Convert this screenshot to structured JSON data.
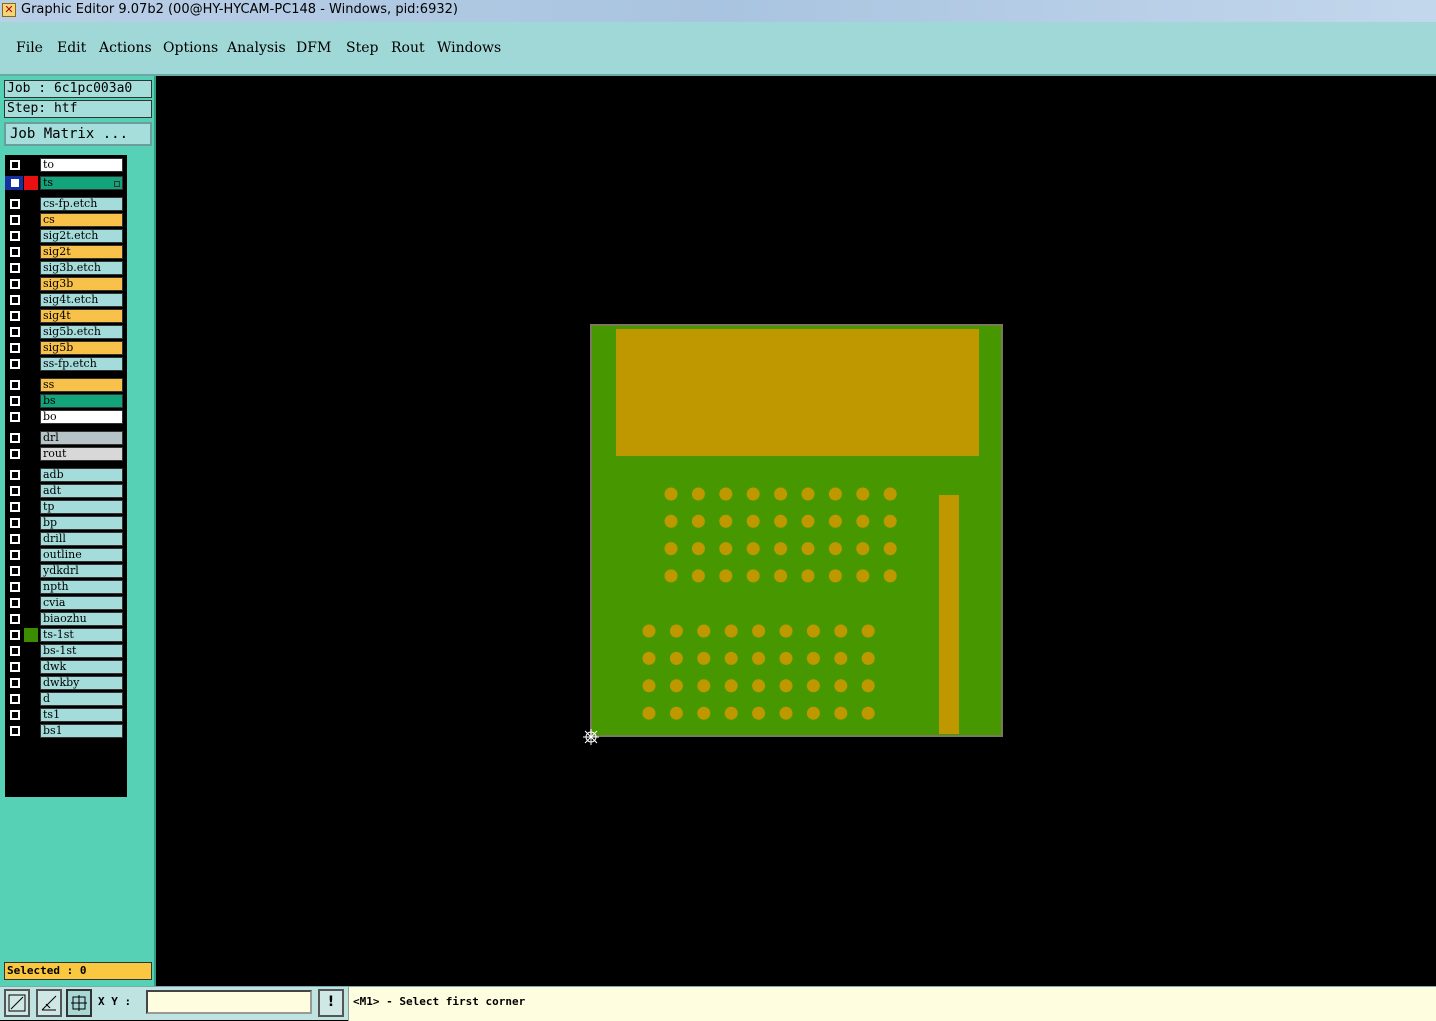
{
  "window": {
    "title": "Graphic Editor 9.07b2 (00@HY-HYCAM-PC148 - Windows, pid:6932)"
  },
  "menu": [
    "File",
    "Edit",
    "Actions",
    "Options",
    "Analysis",
    "DFM",
    "Step",
    "Rout",
    "Windows"
  ],
  "panel": {
    "job": "Job : 6c1pc003a0",
    "step": "Step: htf",
    "job_matrix": "Job Matrix ..."
  },
  "layers": [
    {
      "name": "to",
      "color": "white"
    },
    {
      "name": "ts",
      "color": "teal",
      "active": true,
      "indicator": "#e81010"
    },
    {
      "name": "cs-fp.etch",
      "color": "cyan"
    },
    {
      "name": "cs",
      "color": "orange"
    },
    {
      "name": "sig2t.etch",
      "color": "cyan"
    },
    {
      "name": "sig2t",
      "color": "orange"
    },
    {
      "name": "sig3b.etch",
      "color": "cyan"
    },
    {
      "name": "sig3b",
      "color": "orange"
    },
    {
      "name": "sig4t.etch",
      "color": "cyan"
    },
    {
      "name": "sig4t",
      "color": "orange"
    },
    {
      "name": "sig5b.etch",
      "color": "cyan"
    },
    {
      "name": "sig5b",
      "color": "orange"
    },
    {
      "name": "ss-fp.etch",
      "color": "cyan"
    },
    {
      "name": "ss",
      "color": "orange"
    },
    {
      "name": "bs",
      "color": "teal"
    },
    {
      "name": "bo",
      "color": "white"
    },
    {
      "name": "drl",
      "color": "grey"
    },
    {
      "name": "rout",
      "color": "lgrey"
    },
    {
      "name": "adb",
      "color": "cyan"
    },
    {
      "name": "adt",
      "color": "cyan"
    },
    {
      "name": "tp",
      "color": "cyan"
    },
    {
      "name": "bp",
      "color": "cyan"
    },
    {
      "name": "drill",
      "color": "cyan"
    },
    {
      "name": "outline",
      "color": "cyan"
    },
    {
      "name": "ydkdrl",
      "color": "cyan"
    },
    {
      "name": "npth",
      "color": "cyan"
    },
    {
      "name": "cvia",
      "color": "cyan"
    },
    {
      "name": "biaozhu",
      "color": "cyan"
    },
    {
      "name": "ts-1st",
      "color": "cyan",
      "indicator": "#3c8c00"
    },
    {
      "name": "bs-1st",
      "color": "cyan"
    },
    {
      "name": "dwk",
      "color": "cyan"
    },
    {
      "name": "dwkby",
      "color": "cyan"
    },
    {
      "name": "d",
      "color": "cyan"
    },
    {
      "name": "ts1",
      "color": "cyan"
    },
    {
      "name": "bs1",
      "color": "cyan"
    }
  ],
  "selected": "Selected : 0",
  "bottom": {
    "xy_label": "X Y :",
    "xy_value": "",
    "alert": "!",
    "status": "<M1> - Select first corner"
  },
  "colors": {
    "board": "#479800",
    "pads": "#bf9800",
    "background": "#000000"
  }
}
